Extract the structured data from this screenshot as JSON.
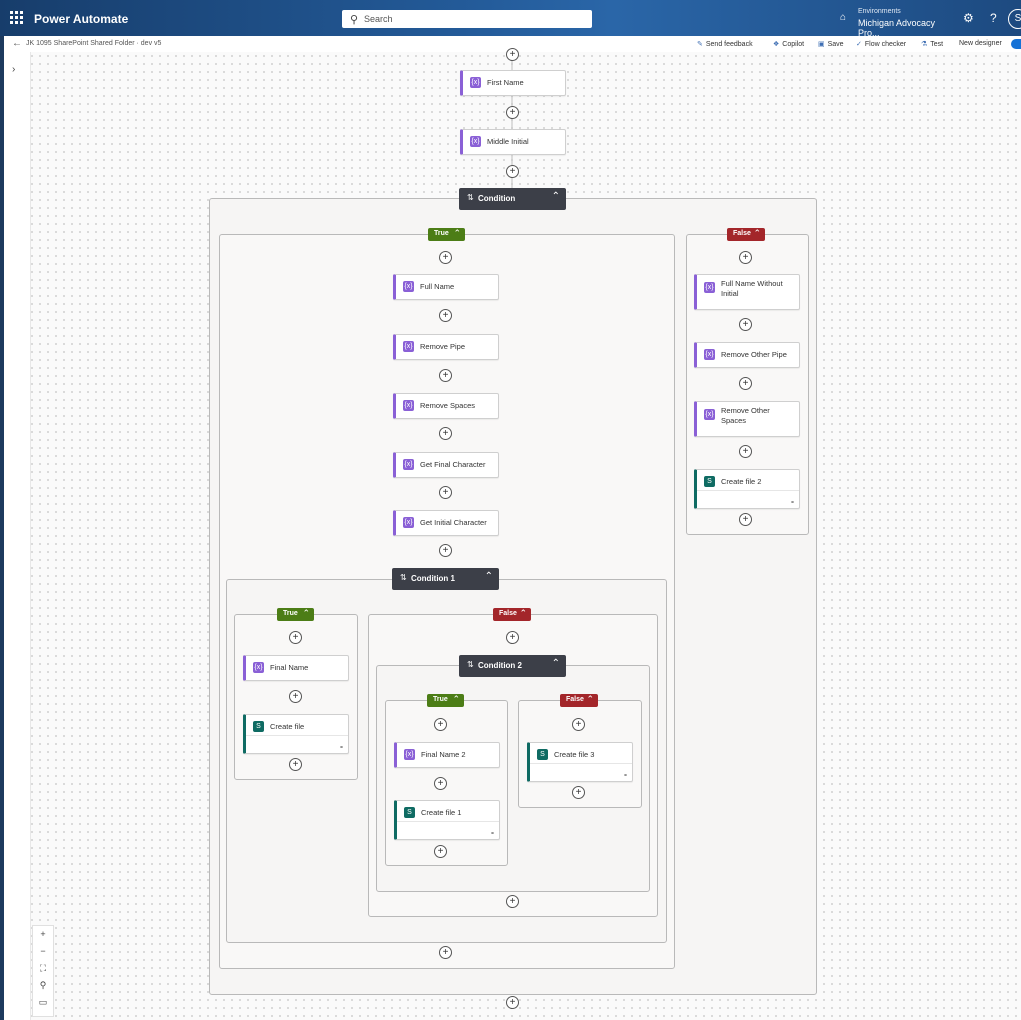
{
  "topbar": {
    "app_title": "Power Automate",
    "search_placeholder": "Search",
    "environment_label": "Environments",
    "environment_name": "Michigan Advocacy Pro...",
    "avatar_initial": "S"
  },
  "commandbar": {
    "breadcrumb": "JK 1095 SharePoint Shared Folder · dev v5",
    "send_feedback": "Send feedback",
    "copilot": "Copilot",
    "save": "Save",
    "flow_checker": "Flow checker",
    "test": "Test",
    "new_designer": "New designer",
    "new_designer_on": true
  },
  "colors": {
    "action_accent": "#8a60d6",
    "sharepoint_accent": "#0f6b63",
    "condition_header": "#3c3f48",
    "true_branch": "#4c7d16",
    "false_branch": "#a3262a"
  },
  "flow": {
    "first_name": "First Name",
    "middle_initial": "Middle Initial",
    "condition": "Condition",
    "true_label": "True",
    "false_label": "False",
    "full_name": "Full Name",
    "remove_pipe": "Remove Pipe",
    "remove_spaces": "Remove Spaces",
    "get_final_character": "Get Final Character",
    "get_initial_character": "Get Initial Character",
    "full_name_without_initial": "Full Name Without Initial",
    "remove_other_pipe": "Remove Other Pipe",
    "remove_other_spaces": "Remove Other Spaces",
    "create_file_2": "Create file 2",
    "condition_1": "Condition 1",
    "final_name": "Final Name",
    "create_file": "Create file",
    "condition_2": "Condition 2",
    "final_name_2": "Final Name 2",
    "create_file_1": "Create file 1",
    "create_file_3": "Create file 3"
  },
  "icons": {
    "waffle": "app-launcher-icon",
    "search": "search-icon",
    "settings": "gear-icon",
    "help": "help-icon",
    "back": "back-arrow-icon",
    "action": "data-operation-icon",
    "sharepoint": "sharepoint-icon",
    "condition": "condition-icon"
  },
  "zoom_controls": [
    "+",
    "−",
    "fit",
    "search",
    "minimap"
  ]
}
